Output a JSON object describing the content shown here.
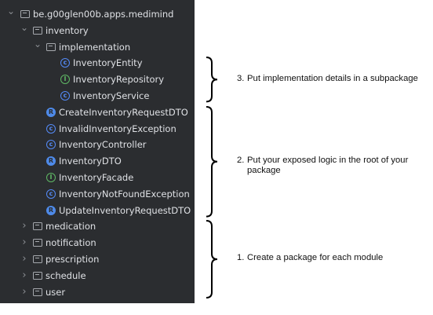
{
  "tree": [
    {
      "label": "be.g00glen00b.apps.medimind",
      "icon": "folder-icon",
      "arrow": "expanded",
      "depth": 0
    },
    {
      "label": "inventory",
      "icon": "folder-icon",
      "arrow": "expanded",
      "depth": 1
    },
    {
      "label": "implementation",
      "icon": "folder-icon",
      "arrow": "expanded",
      "depth": 2
    },
    {
      "label": "InventoryEntity",
      "icon": "class-icon",
      "arrow": "none",
      "depth": 3
    },
    {
      "label": "InventoryRepository",
      "icon": "interface-icon",
      "arrow": "none",
      "depth": 3
    },
    {
      "label": "InventoryService",
      "icon": "class-icon",
      "arrow": "none",
      "depth": 3
    },
    {
      "label": "CreateInventoryRequestDTO",
      "icon": "record-icon",
      "arrow": "none",
      "depth": 2
    },
    {
      "label": "InvalidInventoryException",
      "icon": "class-icon",
      "arrow": "none",
      "depth": 2
    },
    {
      "label": "InventoryController",
      "icon": "class-icon",
      "arrow": "none",
      "depth": 2
    },
    {
      "label": "InventoryDTO",
      "icon": "record-icon",
      "arrow": "none",
      "depth": 2
    },
    {
      "label": "InventoryFacade",
      "icon": "interface-icon",
      "arrow": "none",
      "depth": 2
    },
    {
      "label": "InventoryNotFoundException",
      "icon": "class-icon",
      "arrow": "none",
      "depth": 2
    },
    {
      "label": "UpdateInventoryRequestDTO",
      "icon": "record-icon",
      "arrow": "none",
      "depth": 2
    },
    {
      "label": "medication",
      "icon": "folder-icon",
      "arrow": "collapsed",
      "depth": 1
    },
    {
      "label": "notification",
      "icon": "folder-icon",
      "arrow": "collapsed",
      "depth": 1
    },
    {
      "label": "prescription",
      "icon": "folder-icon",
      "arrow": "collapsed",
      "depth": 1
    },
    {
      "label": "schedule",
      "icon": "folder-icon",
      "arrow": "collapsed",
      "depth": 1
    },
    {
      "label": "user",
      "icon": "folder-icon",
      "arrow": "collapsed",
      "depth": 1
    }
  ],
  "annotations": [
    {
      "number": "3.",
      "text": "Put implementation details in a subpackage",
      "brace_rows": [
        3,
        5
      ]
    },
    {
      "number": "2.",
      "text": "Put your exposed logic in the root of your package",
      "brace_rows": [
        6,
        12
      ]
    },
    {
      "number": "1.",
      "text": "Create a package for each module",
      "brace_rows": [
        13,
        17
      ]
    }
  ],
  "colors": {
    "panel_bg": "#2b2d30",
    "tree_text": "#dfe1e5",
    "class_icon": "#548af7",
    "interface_icon": "#5fb865",
    "record_icon": "#4e8ae9",
    "brace": "#000000"
  }
}
